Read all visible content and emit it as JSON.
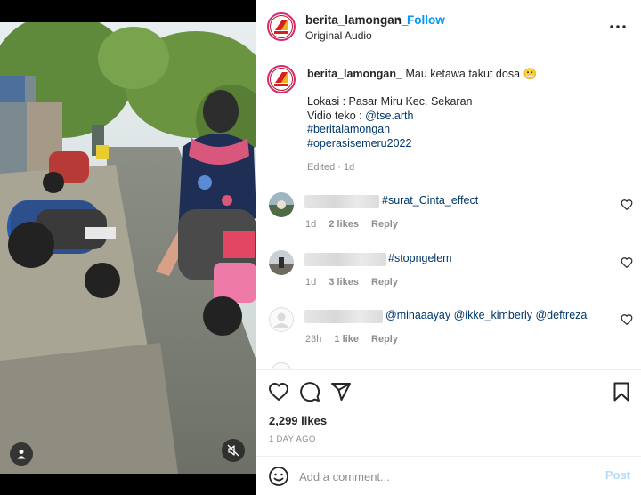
{
  "header": {
    "username": "berita_lamongan_",
    "separator": "•",
    "follow_label": "Follow",
    "audio": "Original Audio",
    "avatar_logo_text": "BERITA"
  },
  "caption": {
    "username": "berita_lamongan_",
    "text": "Mau ketawa takut dosa",
    "emoji": "😬",
    "location": "Lokasi : Pasar Miru Kec. Sekaran",
    "video_by_prefix": "Vidio teko : ",
    "video_by_handle": "@tse.arth",
    "hashtag_1": "#beritalamongan",
    "hashtag_2": "#operasisemeru2022",
    "meta": "Edited · 1d"
  },
  "comments": [
    {
      "text": "#surat_Cinta_effect",
      "time": "1d",
      "likes": "2 likes",
      "reply": "Reply"
    },
    {
      "text": "#stopngelem",
      "time": "1d",
      "likes": "3 likes",
      "reply": "Reply"
    },
    {
      "text": "@minaaayay @ikke_kimberly @deftreza",
      "time": "23h",
      "likes": "1 like",
      "reply": "Reply"
    }
  ],
  "actions": {
    "likes_count": "2,299 likes",
    "date": "1 DAY AGO"
  },
  "comment_box": {
    "placeholder": "Add a comment...",
    "post_label": "Post"
  },
  "icons": {
    "tag": "person-tag-icon",
    "mute": "speaker-muted-icon",
    "more": "more-options-icon",
    "like": "heart-icon",
    "comment": "comment-bubble-icon",
    "share": "paper-plane-icon",
    "save": "bookmark-icon",
    "emoji": "smiley-icon"
  },
  "colors": {
    "accent": "#0095f6",
    "link": "#00376b",
    "muted": "#8e8e8e",
    "post_disabled": "#b3dbff"
  }
}
